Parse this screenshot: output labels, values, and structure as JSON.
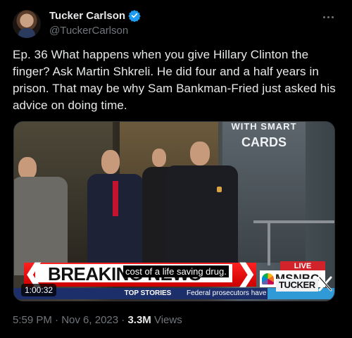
{
  "author": {
    "display_name": "Tucker Carlson",
    "handle": "@TuckerCarlson",
    "verified": true
  },
  "tweet": {
    "text": "Ep. 36  What happens when you give Hillary Clinton the finger? Ask Martin Shkreli. He did four and a half years in prison. That may be why Sam Bankman-Fried just asked his advice on doing time."
  },
  "video": {
    "duration": "1:00:32",
    "sign_line1": "WITH SMART",
    "sign_line2": "CARDS",
    "breaking_label": "BREAKING NEWS",
    "caption": "cost of a life saving drug.",
    "live_label": "LIVE",
    "network": "MSNBC",
    "ticker_label": "TOP STORIES",
    "ticker_text": "Federal prosecutors have",
    "show_logo": "TUCKER"
  },
  "meta": {
    "time": "5:59 PM",
    "date": "Nov 6, 2023",
    "views_count": "3.3M",
    "views_label": "Views"
  },
  "colors": {
    "background": "#000000",
    "text": "#e7e9ea",
    "secondary": "#71767b",
    "verified": "#1d9bf0"
  }
}
